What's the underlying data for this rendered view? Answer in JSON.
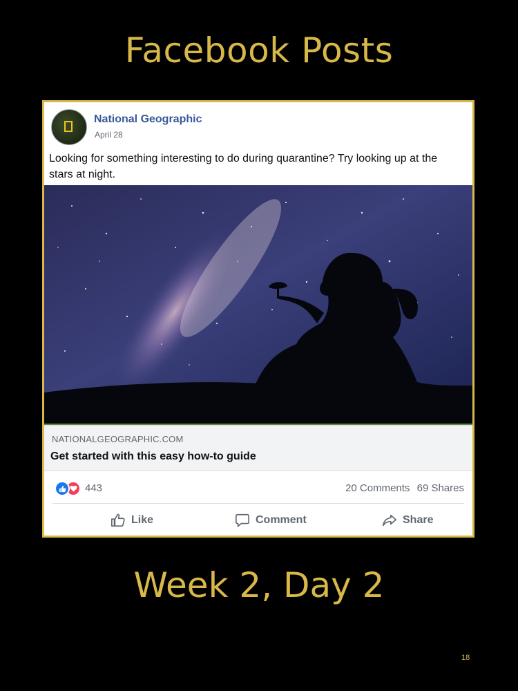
{
  "slide": {
    "title": "Facebook Posts",
    "subtitle": "Week 2, Day 2",
    "page_number": "18"
  },
  "post": {
    "page_name": "National Geographic",
    "date": "April 28",
    "text": "Looking for something interesting to do during quarantine?  Try looking up at the stars at night.",
    "link": {
      "domain": "NATIONALGEOGRAPHIC.COM",
      "title": "Get started with this easy how-to guide"
    },
    "reactions": {
      "icons": [
        "like-reaction-icon",
        "love-reaction-icon"
      ],
      "count": "443"
    },
    "comments": "20 Comments",
    "shares": "69 Shares",
    "actions": {
      "like": "Like",
      "comment": "Comment",
      "share": "Share"
    }
  },
  "colors": {
    "title_gold": "#d9b84a",
    "facebook_blue": "#385898",
    "like_blue": "#1877f2",
    "love_red": "#f33e58"
  }
}
